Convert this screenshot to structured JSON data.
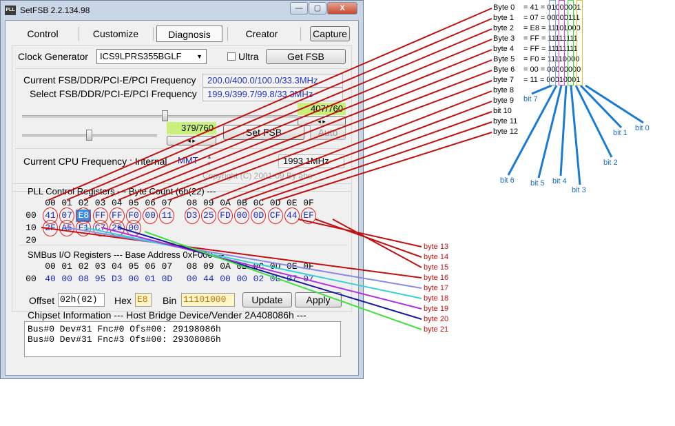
{
  "window": {
    "title": "SetFSB 2.2.134.98",
    "app_icon": "PLL",
    "minimize_glyph": "—",
    "maximize_glyph": "▢",
    "close_glyph": "X"
  },
  "tabs": [
    "Control",
    "Customize",
    "Diagnosis",
    "Creator"
  ],
  "capture_label": "Capture",
  "clock": {
    "label": "Clock Generator",
    "selected": "ICS9LPRS355BGLF",
    "ultra_label": "Ultra",
    "get_fsb_label": "Get FSB"
  },
  "freq": {
    "current_label": "Current FSB/DDR/PCI-E/PCI Frequency",
    "current_value": "200.0/400.0/100.0/33.3MHz",
    "select_label": "Select FSB/DDR/PCI-E/PCI Frequency",
    "select_value": "199.9/399.7/99.8/33.3MHz",
    "slider1_readout": "407/760",
    "slider2_readout": "379/760",
    "set_fsb_label": "Set FSB",
    "auto_label": "Auto"
  },
  "cpu": {
    "label": "Current CPU Frequency : Internal",
    "source": "MMT",
    "value": "1993.1MHz",
    "copyright": "Copyright (C) 2001-09 By abo"
  },
  "pll": {
    "header": "PLL Control Registers  --- Byte Count (6h(22) ---",
    "columns": [
      "00",
      "01",
      "02",
      "03",
      "04",
      "05",
      "06",
      "07",
      "08",
      "09",
      "0A",
      "0B",
      "0C",
      "0D",
      "0E",
      "0F"
    ],
    "rows": [
      {
        "label": "00",
        "values": [
          "41",
          "07",
          "E8",
          "FF",
          "FF",
          "F0",
          "00",
          "11",
          "D3",
          "25",
          "FD",
          "00",
          "0D",
          "CF",
          "44",
          "EF"
        ]
      },
      {
        "label": "10",
        "values": [
          "2F",
          "A5",
          "F1",
          "C7",
          "26",
          "00"
        ]
      },
      {
        "label": "20",
        "values": []
      }
    ]
  },
  "smbus": {
    "header": "SMBus I/O Registers  --- Base Address 0xF000 ---",
    "columns": [
      "00",
      "01",
      "02",
      "03",
      "04",
      "05",
      "06",
      "07",
      "08",
      "09",
      "0A",
      "0B",
      "0C",
      "0D",
      "0E",
      "0F"
    ],
    "row_label": "00",
    "values": [
      "40",
      "00",
      "08",
      "95",
      "D3",
      "00",
      "01",
      "0D",
      "00",
      "44",
      "00",
      "00",
      "02",
      "0E",
      "07",
      "07"
    ]
  },
  "offset": {
    "offset_label": "Offset",
    "offset_value": "02h(02)",
    "hex_label": "Hex",
    "hex_value": "E8",
    "bin_label": "Bin",
    "bin_value": "11101000",
    "update_label": "Update",
    "apply_label": "Apply"
  },
  "chipset": {
    "label": "Chipset Information  --- Host Bridge Device/Vender 2A408086h ---",
    "lines": [
      "Bus#0 Dev#31 Fnc#0 Ofs#00: 29198086h",
      "Bus#0 Dev#31 Fnc#3 Ofs#00: 29308086h"
    ]
  },
  "annotations": {
    "bytes_left": [
      "Byte 0",
      "byte 1",
      "byte 2",
      "Byte 3",
      "byte 4",
      "Byte 5",
      "Byte 6",
      "byte 7",
      "byte 8",
      "byte 9",
      "bit 10",
      "byte 11",
      "byte 12"
    ],
    "byte_values": [
      "= 41 = 01000001",
      "= 07 = 00000111",
      "= E8 = 11101000",
      "= FF = 11111111",
      "= FF = 11111111",
      "= F0 = 11110000",
      "= 00 = 00000000",
      "= 11 = 00010001"
    ],
    "bytes_right": [
      "byte 13",
      "byte 14",
      "byte 15",
      "byte 16",
      "byte 17",
      "byte 18",
      "byte 19",
      "byte 20",
      "byte 21"
    ],
    "bits": [
      "bit 7",
      "bit 6",
      "bit 5",
      "bit 4",
      "bit 3",
      "bit 2",
      "bit 1",
      "bit 0"
    ]
  },
  "colors": {
    "annot_red": "#c01010",
    "annot_blue": "#1a6fc9",
    "line_blue": "#1a7ad6",
    "readout_bg": "#c9f07a",
    "value_blue": "#1b2bb8"
  }
}
